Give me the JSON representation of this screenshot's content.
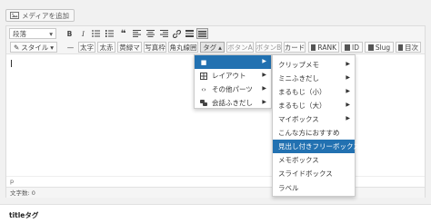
{
  "media_button": {
    "label": "メディアを追加"
  },
  "toolbar1": {
    "format_select": "段落",
    "icons": [
      "bold-icon",
      "italic-icon",
      "bullet-list-icon",
      "numbered-list-icon",
      "blockquote-icon",
      "align-left-icon",
      "align-center-icon",
      "align-right-icon",
      "link-icon",
      "unlink-icon",
      "horizontal-rule-icon",
      "toolbar-toggle-icon"
    ],
    "bold_glyph": "B",
    "italic_glyph": "I"
  },
  "toolbar2": {
    "style_label": "スタイル",
    "dash": "—",
    "buttons": [
      "太字",
      "太赤",
      "黄緑マ",
      "写真枠",
      "角丸線囲",
      "タグ",
      "ボタンA",
      "ボタンB",
      "カード"
    ],
    "bookmark_buttons": [
      "RANK",
      "ID",
      "Slug",
      "目次"
    ]
  },
  "editor": {
    "path": "p",
    "word_count": "文字数: 0"
  },
  "below_label": "titleタグ",
  "menu_main": [
    {
      "label": "レイアウト",
      "icon": "grid-icon"
    },
    {
      "label": "その他パーツ",
      "icon": "code-icon"
    },
    {
      "label": "会話ふきだし",
      "icon": "chat-icon"
    }
  ],
  "menu_sub": [
    {
      "label": "クリップメモ",
      "has_sub": true
    },
    {
      "label": "ミニふきだし",
      "has_sub": true
    },
    {
      "label": "まるもじ（小）",
      "has_sub": true
    },
    {
      "label": "まるもじ（大）",
      "has_sub": true
    },
    {
      "label": "マイボックス",
      "has_sub": true
    },
    {
      "label": "こんな方におすすめ",
      "has_sub": false
    },
    {
      "label": "見出し付きフリーボックス",
      "has_sub": false
    },
    {
      "label": "メモボックス",
      "has_sub": false
    },
    {
      "label": "スライドボックス",
      "has_sub": false
    },
    {
      "label": "ラベル",
      "has_sub": false
    }
  ],
  "colors": {
    "highlight": "#2271b1"
  }
}
